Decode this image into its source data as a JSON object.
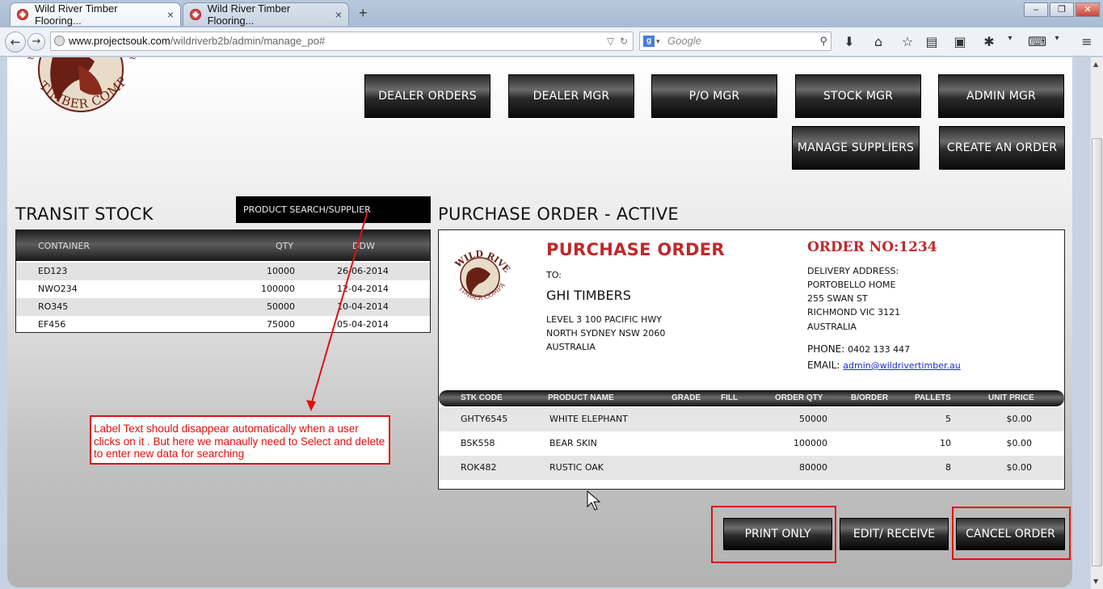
{
  "browser": {
    "tabs": [
      {
        "title": "Wild River Timber Flooring...",
        "close": "×"
      },
      {
        "title": "Wild River Timber Flooring...",
        "close": "×"
      }
    ],
    "new_tab": "+",
    "window_buttons": [
      "‒",
      "❐",
      "✕"
    ],
    "url_domain": "www.projectsouk.com",
    "url_path": "/wildriverb2b/admin/manage_po#",
    "search_placeholder": "Google",
    "toolbar_icons": [
      "download-icon",
      "home-icon",
      "bookmark-star-icon",
      "reader-icon",
      "addon-icon",
      "firebug-icon",
      "devtools-icon",
      "menu-icon"
    ]
  },
  "page": {
    "logo_text": "TIMBER COMPANY",
    "menu": [
      "DEALER ORDERS",
      "DEALER MGR",
      "P/O MGR",
      "STOCK MGR",
      "ADMIN MGR",
      "MANAGE SUPPLIERS",
      "CREATE AN ORDER"
    ],
    "transit": {
      "title": "TRANSIT STOCK",
      "search_value": "PRODUCT SEARCH/SUPPLIER",
      "headers": [
        "CONTAINER",
        "QTY",
        "DDW"
      ],
      "rows": [
        [
          "ED123",
          "10000",
          "26-06-2014"
        ],
        [
          "NWO234",
          "100000",
          "12-04-2014"
        ],
        [
          "RO345",
          "50000",
          "10-04-2014"
        ],
        [
          "EF456",
          "75000",
          "05-04-2014"
        ]
      ]
    },
    "po": {
      "section_title": "PURCHASE ORDER - ACTIVE",
      "logo_top": "WILD RIVER",
      "logo_bottom": "TIMBER COMPANY",
      "title": "PURCHASE ORDER",
      "to_label": "TO:",
      "supplier": "GHI TIMBERS",
      "supplier_address": [
        "LEVEL 3 100 PACIFIC HWY",
        "NORTH SYDNEY NSW 2060",
        "AUSTRALIA"
      ],
      "order_no": "ORDER NO:1234",
      "delivery_label": "DELIVERY ADDRESS:",
      "delivery_address": [
        "PORTOBELLO HOME",
        "255 SWAN ST",
        "RICHMOND VIC 3121",
        "AUSTRALIA"
      ],
      "phone_label": "PHONE:",
      "phone": "0402 133 447",
      "email_label": "EMAIL:",
      "email": "admin@wildrivertimber.au",
      "headers": [
        "STK CODE",
        "PRODUCT NAME",
        "GRADE",
        "FILL",
        "ORDER QTY",
        "B/ORDER",
        "PALLETS",
        "UNIT PRICE"
      ],
      "rows": [
        [
          "GHTY6545",
          "WHITE ELEPHANT",
          "50000",
          "5",
          "$0.00"
        ],
        [
          "BSK558",
          "BEAR SKIN",
          "100000",
          "10",
          "$0.00"
        ],
        [
          "ROK482",
          "RUSTIC OAK",
          "80000",
          "8",
          "$0.00"
        ]
      ]
    },
    "actions": [
      "PRINT ONLY",
      "EDIT/ RECEIVE",
      "CANCEL ORDER"
    ],
    "annotation": "Label Text should disappear automatically when a user clicks on it . But here we manaully need to Select and delete  to enter new data for searching"
  }
}
